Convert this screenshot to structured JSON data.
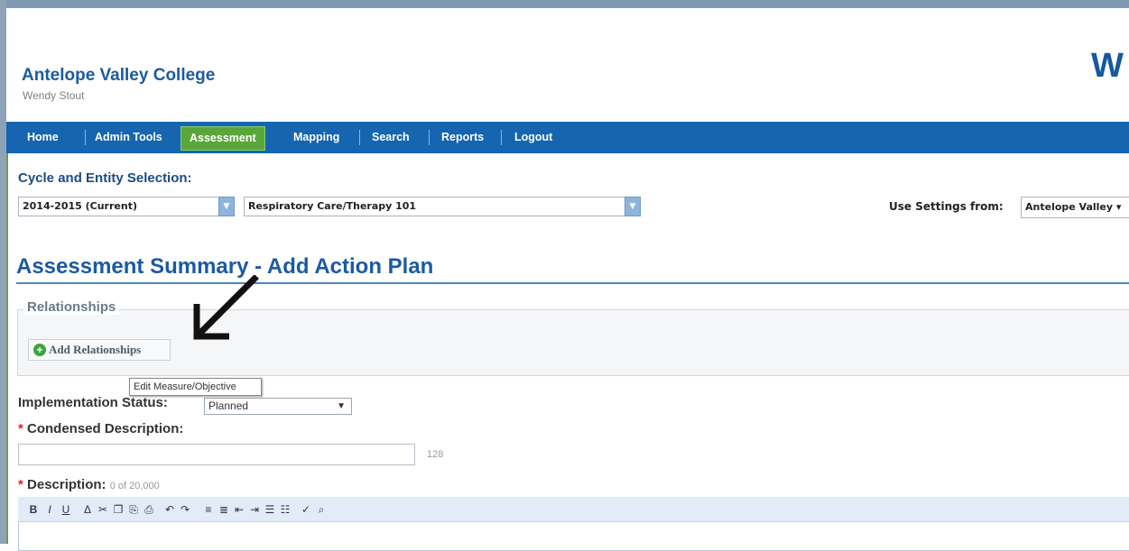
{
  "header": {
    "college": "Antelope Valley College",
    "user": "Wendy Stout",
    "brand_letter": "W"
  },
  "nav": {
    "home": "Home",
    "admin_tools": "Admin Tools",
    "assessment": "Assessment",
    "mapping": "Mapping",
    "search": "Search",
    "reports": "Reports",
    "logout": "Logout",
    "active": "Assessment"
  },
  "selection": {
    "label": "Cycle and Entity Selection:",
    "cycle": "2014-2015  (Current)",
    "entity": "Respiratory Care/Therapy 101",
    "use_settings_label": "Use Settings from:",
    "use_settings_value": "Antelope Valley"
  },
  "page": {
    "title": "Assessment Summary - Add Action Plan"
  },
  "relationships": {
    "legend": "Relationships",
    "add_button": "Add Relationships"
  },
  "tooltip": "Edit Measure/Objective",
  "form": {
    "implementation_label": "Implementation Status:",
    "implementation_value": "Planned",
    "condensed_label": "Condensed Description:",
    "condensed_value": "",
    "condensed_remaining": "128",
    "description_label": "Description:",
    "description_count": "0 of 20,000",
    "required_marker": "*"
  },
  "toolbar": {
    "bold": "B",
    "italic": "I",
    "underline": "U",
    "find": "Δ",
    "cut": "✂",
    "copy": "❐",
    "paste": "⎘",
    "paste_word": "⎙",
    "undo": "↶",
    "redo": "↷",
    "align_left": "≡",
    "align_center": "≣",
    "outdent": "⇤",
    "indent": "⇥",
    "ordered_list": "☰",
    "unordered_list": "☷",
    "spellcheck": "✓",
    "preview": "⌕"
  },
  "colors": {
    "nav_bg": "#1565b0",
    "active_tab": "#5aa63a",
    "title": "#1c5aa2"
  }
}
